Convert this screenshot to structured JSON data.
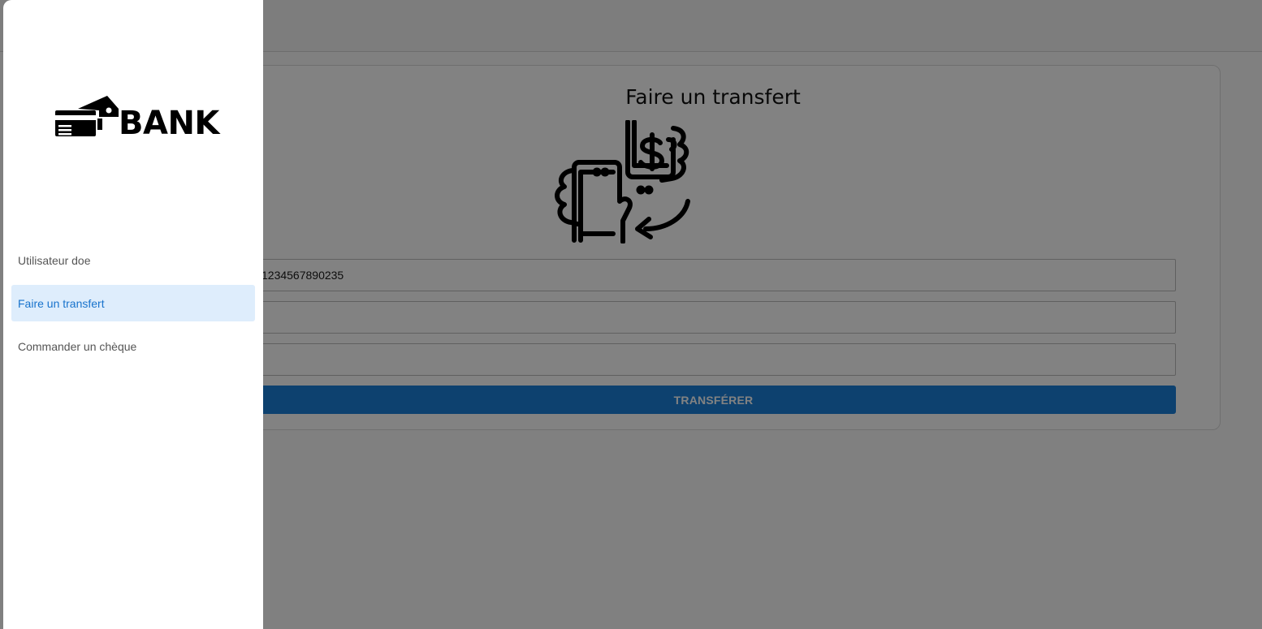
{
  "brand": {
    "name": "BANK"
  },
  "transfer": {
    "title": "Faire un transfert",
    "account_value": "1234567890235",
    "amount_value": "",
    "description_value": "",
    "submit_label": "TRANSFÉRER"
  },
  "sidebar": {
    "items": [
      {
        "label": "Utilisateur doe",
        "active": false
      },
      {
        "label": "Faire un transfert",
        "active": true
      },
      {
        "label": "Commander un chèque",
        "active": false
      }
    ]
  },
  "colors": {
    "accent": "#1a80d9",
    "active_item_bg": "#deedfc",
    "active_item_text": "#1873cc",
    "backdrop": "rgba(0,0,0,0.49)"
  }
}
